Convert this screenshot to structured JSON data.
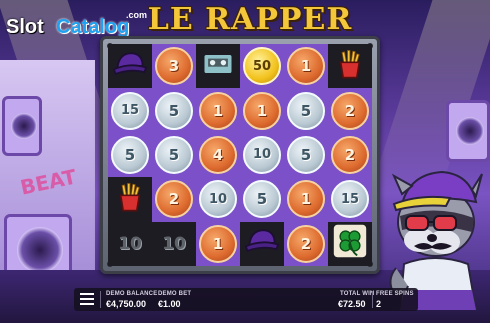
{
  "watermark": {
    "part1": "Slot",
    "part2": "Catalog",
    "suffix": ".com"
  },
  "game_title": "LE RAPPER",
  "grid": [
    [
      {
        "kind": "hat"
      },
      {
        "kind": "coin",
        "metal": "bronze",
        "value": "3"
      },
      {
        "kind": "cassette"
      },
      {
        "kind": "coin",
        "metal": "gold",
        "value": "50"
      },
      {
        "kind": "coin",
        "metal": "bronze",
        "value": "1"
      },
      {
        "kind": "fries"
      }
    ],
    [
      {
        "kind": "coin",
        "metal": "silver",
        "value": "15"
      },
      {
        "kind": "coin",
        "metal": "silver",
        "value": "5"
      },
      {
        "kind": "coin",
        "metal": "bronze",
        "value": "1"
      },
      {
        "kind": "coin",
        "metal": "bronze",
        "value": "1"
      },
      {
        "kind": "coin",
        "metal": "silver",
        "value": "5"
      },
      {
        "kind": "coin",
        "metal": "bronze",
        "value": "2"
      }
    ],
    [
      {
        "kind": "coin",
        "metal": "silver",
        "value": "5"
      },
      {
        "kind": "coin",
        "metal": "silver",
        "value": "5"
      },
      {
        "kind": "coin",
        "metal": "bronze",
        "value": "4"
      },
      {
        "kind": "coin",
        "metal": "silver",
        "value": "10"
      },
      {
        "kind": "coin",
        "metal": "silver",
        "value": "5"
      },
      {
        "kind": "coin",
        "metal": "bronze",
        "value": "2"
      }
    ],
    [
      {
        "kind": "fries"
      },
      {
        "kind": "coin",
        "metal": "bronze",
        "value": "2"
      },
      {
        "kind": "coin",
        "metal": "silver",
        "value": "10"
      },
      {
        "kind": "coin",
        "metal": "silver",
        "value": "5"
      },
      {
        "kind": "coin",
        "metal": "bronze",
        "value": "1"
      },
      {
        "kind": "coin",
        "metal": "silver",
        "value": "15"
      }
    ],
    [
      {
        "kind": "plain",
        "value": "10"
      },
      {
        "kind": "plain",
        "value": "10"
      },
      {
        "kind": "coin",
        "metal": "bronze",
        "value": "1"
      },
      {
        "kind": "hat"
      },
      {
        "kind": "coin",
        "metal": "bronze",
        "value": "2"
      },
      {
        "kind": "clover"
      }
    ]
  ],
  "lit_cells": [
    [
      1,
      0
    ],
    [
      1,
      1
    ],
    [
      1,
      2
    ],
    [
      1,
      3
    ],
    [
      1,
      4
    ],
    [
      1,
      5
    ],
    [
      2,
      0
    ],
    [
      2,
      1
    ],
    [
      2,
      2
    ],
    [
      2,
      3
    ],
    [
      2,
      4
    ],
    [
      2,
      5
    ],
    [
      3,
      1
    ],
    [
      3,
      2
    ],
    [
      3,
      3
    ],
    [
      3,
      4
    ],
    [
      3,
      5
    ],
    [
      4,
      2
    ],
    [
      4,
      4
    ],
    [
      0,
      1
    ],
    [
      0,
      3
    ],
    [
      0,
      4
    ]
  ],
  "bottom_bar": {
    "demo_balance_label": "DEMO BALANCE",
    "demo_balance_value": "€4,750.00",
    "demo_bet_label": "DEMO BET",
    "demo_bet_value": "€1.00",
    "total_win_label": "TOTAL WIN",
    "total_win_value": "€72.50",
    "free_spins_label": "FREE SPINS",
    "free_spins_value": "2"
  },
  "graffiti_text": "BEAT",
  "colors": {
    "bronze": "#dd6a2e",
    "silver": "#b9c8d2",
    "gold": "#f2c21d",
    "lit_cell": "#7c50c8",
    "title": "#f4c63a"
  }
}
